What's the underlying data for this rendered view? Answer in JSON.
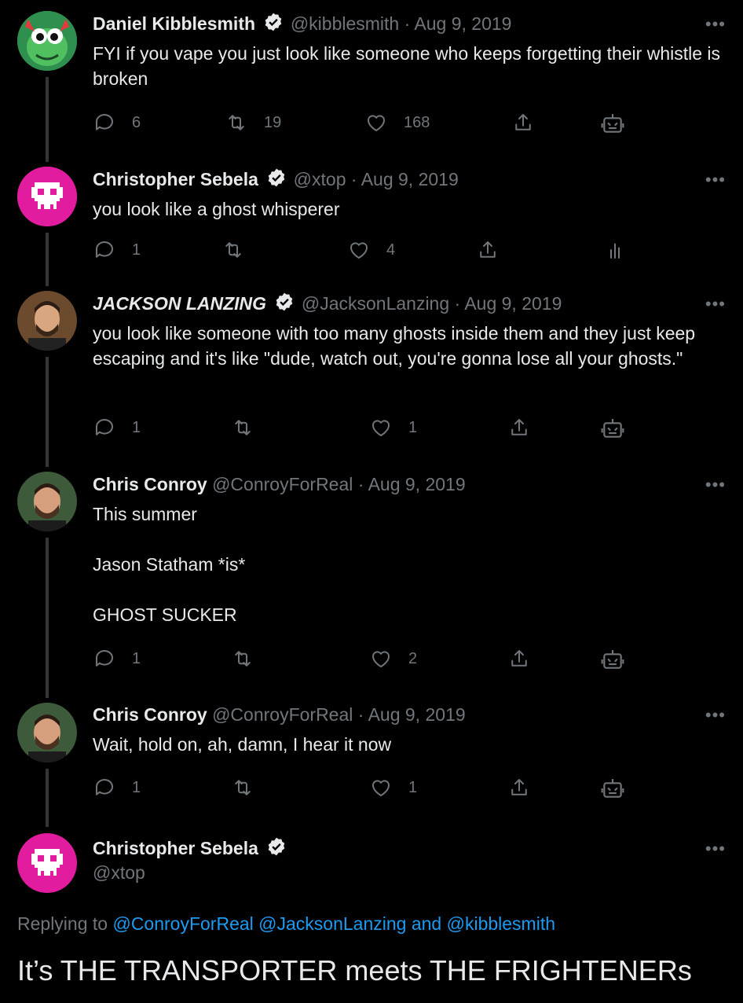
{
  "tweets": [
    {
      "name": "Daniel Kibblesmith",
      "handle": "@kibblesmith",
      "date": "Aug 9, 2019",
      "text": "FYI if you vape you just look like someone who keeps forgetting their whistle is broken",
      "replies": "6",
      "retweets": "19",
      "likes": "168",
      "extra_icon": "robot-icon"
    },
    {
      "name": "Christopher Sebela",
      "handle": "@xtop",
      "date": "Aug 9, 2019",
      "text": "you look like a ghost whisperer",
      "replies": "1",
      "retweets": "",
      "likes": "4",
      "extra_icon": "analytics-icon"
    },
    {
      "name": "JACKSON LANZING",
      "handle": "@JacksonLanzing",
      "date": "Aug 9, 2019",
      "text": "you look like someone with too many ghosts inside them and they just keep escaping and it's like \"dude, watch out, you're gonna lose all your ghosts.\"",
      "replies": "1",
      "retweets": "",
      "likes": "1",
      "extra_icon": "robot-icon"
    },
    {
      "name": "Chris Conroy",
      "handle": "@ConroyForReal",
      "date": "Aug 9, 2019",
      "text": "This summer\n\nJason Statham *is*\n\nGHOST SUCKER",
      "replies": "1",
      "retweets": "",
      "likes": "2",
      "extra_icon": "robot-icon"
    },
    {
      "name": "Chris Conroy",
      "handle": "@ConroyForReal",
      "date": "Aug 9, 2019",
      "text": "Wait, hold on, ah, damn, I hear it now",
      "replies": "1",
      "retweets": "",
      "likes": "1",
      "extra_icon": "robot-icon"
    }
  ],
  "main": {
    "name": "Christopher Sebela",
    "handle": "@xtop",
    "replying_prefix": "Replying to",
    "replying_1": "@ConroyForReal",
    "replying_2": "@JacksonLanzing",
    "replying_and": "and",
    "replying_3": "@kibblesmith",
    "text": "It’s THE TRANSPORTER meets THE FRIGHTENERs"
  },
  "separator": "·",
  "more_label": "•••",
  "colors": {
    "background": "#000000",
    "text": "#e7e9ea",
    "muted": "#71767b",
    "link": "#1d9bf0",
    "verified": "#e7e9ea"
  }
}
